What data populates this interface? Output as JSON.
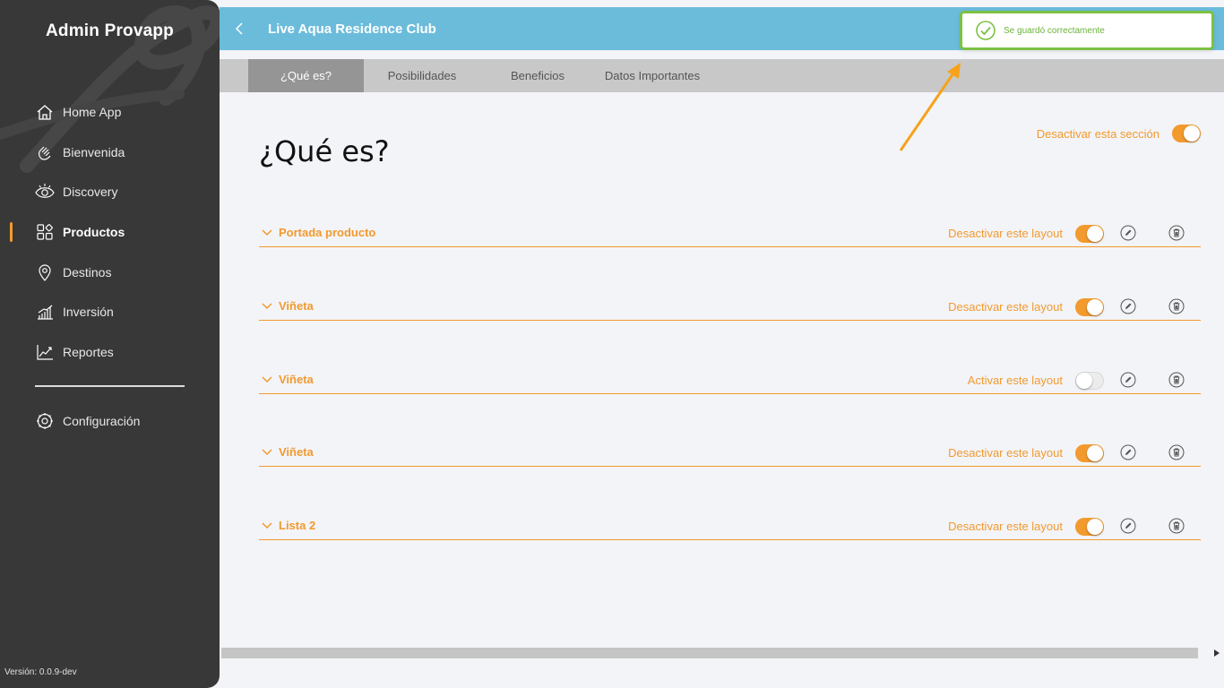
{
  "sidebar": {
    "brand": "Admin Provapp",
    "items": [
      {
        "label": "Home App",
        "icon": "home-icon"
      },
      {
        "label": "Bienvenida",
        "icon": "hand-wave-icon"
      },
      {
        "label": "Discovery",
        "icon": "eye-icon"
      },
      {
        "label": "Productos",
        "icon": "grid-icon",
        "active": true
      },
      {
        "label": "Destinos",
        "icon": "map-pin-icon"
      },
      {
        "label": "Inversión",
        "icon": "bar-chart-icon"
      },
      {
        "label": "Reportes",
        "icon": "line-chart-icon"
      }
    ],
    "config": {
      "label": "Configuración",
      "icon": "gear-icon"
    },
    "version": "Versión: 0.0.9-dev"
  },
  "header": {
    "title": "Live Aqua Residence Club"
  },
  "tabs": [
    {
      "label": "¿Qué es?",
      "active": true
    },
    {
      "label": "Posibilidades"
    },
    {
      "label": "Beneficios"
    },
    {
      "label": "Datos Importantes"
    }
  ],
  "main": {
    "title": "¿Qué es?",
    "section_toggle_label": "Desactivar esta sección",
    "section_enabled": true,
    "layouts": [
      {
        "name": "Portada producto",
        "action_label": "Desactivar este layout",
        "enabled": true
      },
      {
        "name": "Viñeta",
        "action_label": "Desactivar este layout",
        "enabled": true
      },
      {
        "name": "Viñeta",
        "action_label": "Activar este layout",
        "enabled": false
      },
      {
        "name": "Viñeta",
        "action_label": "Desactivar este layout",
        "enabled": true
      },
      {
        "name": "Lista 2",
        "action_label": "Desactivar este layout",
        "enabled": true
      }
    ]
  },
  "toast": {
    "message": "Se guardó correctamente"
  },
  "colors": {
    "accent": "#f29a2e",
    "header": "#6bbcdb",
    "sidebar": "#383838",
    "success": "#7cc144"
  }
}
